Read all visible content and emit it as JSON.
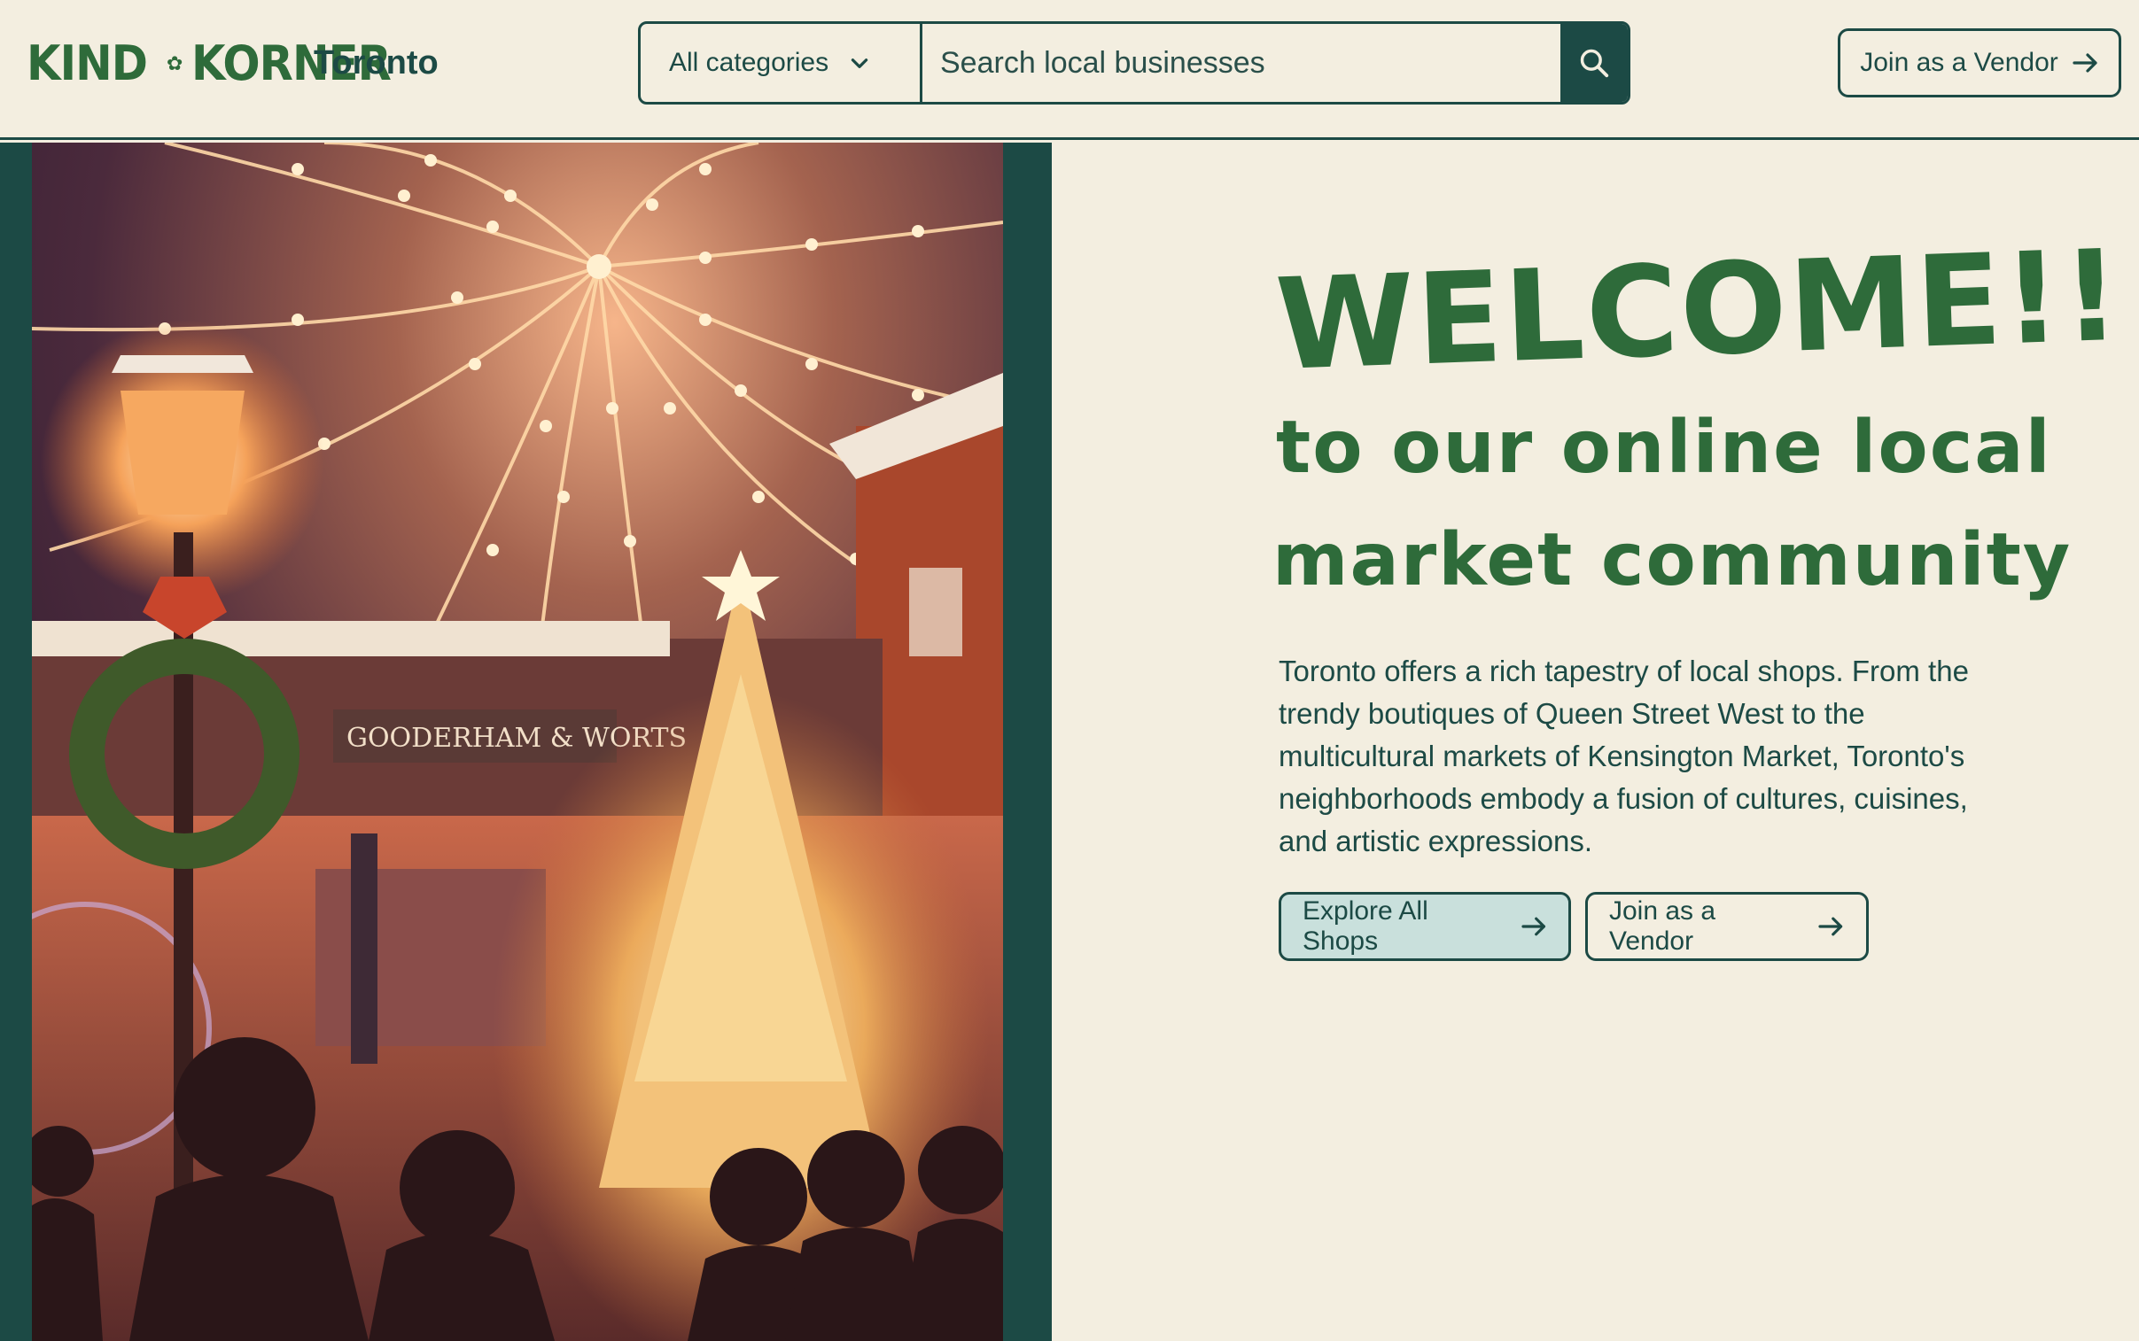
{
  "header": {
    "logo_left": "KIND",
    "logo_right": "KORNER",
    "city": "Toronto",
    "category_label": "All categories",
    "search_placeholder": "Search local businesses",
    "vendor_button": "Join as a Vendor"
  },
  "hero": {
    "image_alt": "Illustration of a winter holiday market at night with string lights, a lit Christmas tree, lamp post with wreath, and silhouettes of people",
    "sign_text": "GOODERHAM & WORTS",
    "welcome": "WELCOME!!",
    "tagline_line1": "to our online local",
    "tagline_line2": "market community",
    "description": "Toronto offers a rich tapestry of local shops. From the trendy boutiques of Queen Street West to the multicultural markets of Kensington Market, Toronto's neighborhoods embody a fusion of cultures, cuisines, and artistic expressions.",
    "explore_button": "Explore All Shops",
    "vendor_button": "Join as a Vendor"
  },
  "colors": {
    "background": "#f3eee0",
    "dark_teal": "#1c4a45",
    "green": "#2e6b3a",
    "button_primary_bg": "#c9e0dc"
  },
  "icons": [
    "chevron-down-icon",
    "search-icon",
    "arrow-right-icon"
  ]
}
